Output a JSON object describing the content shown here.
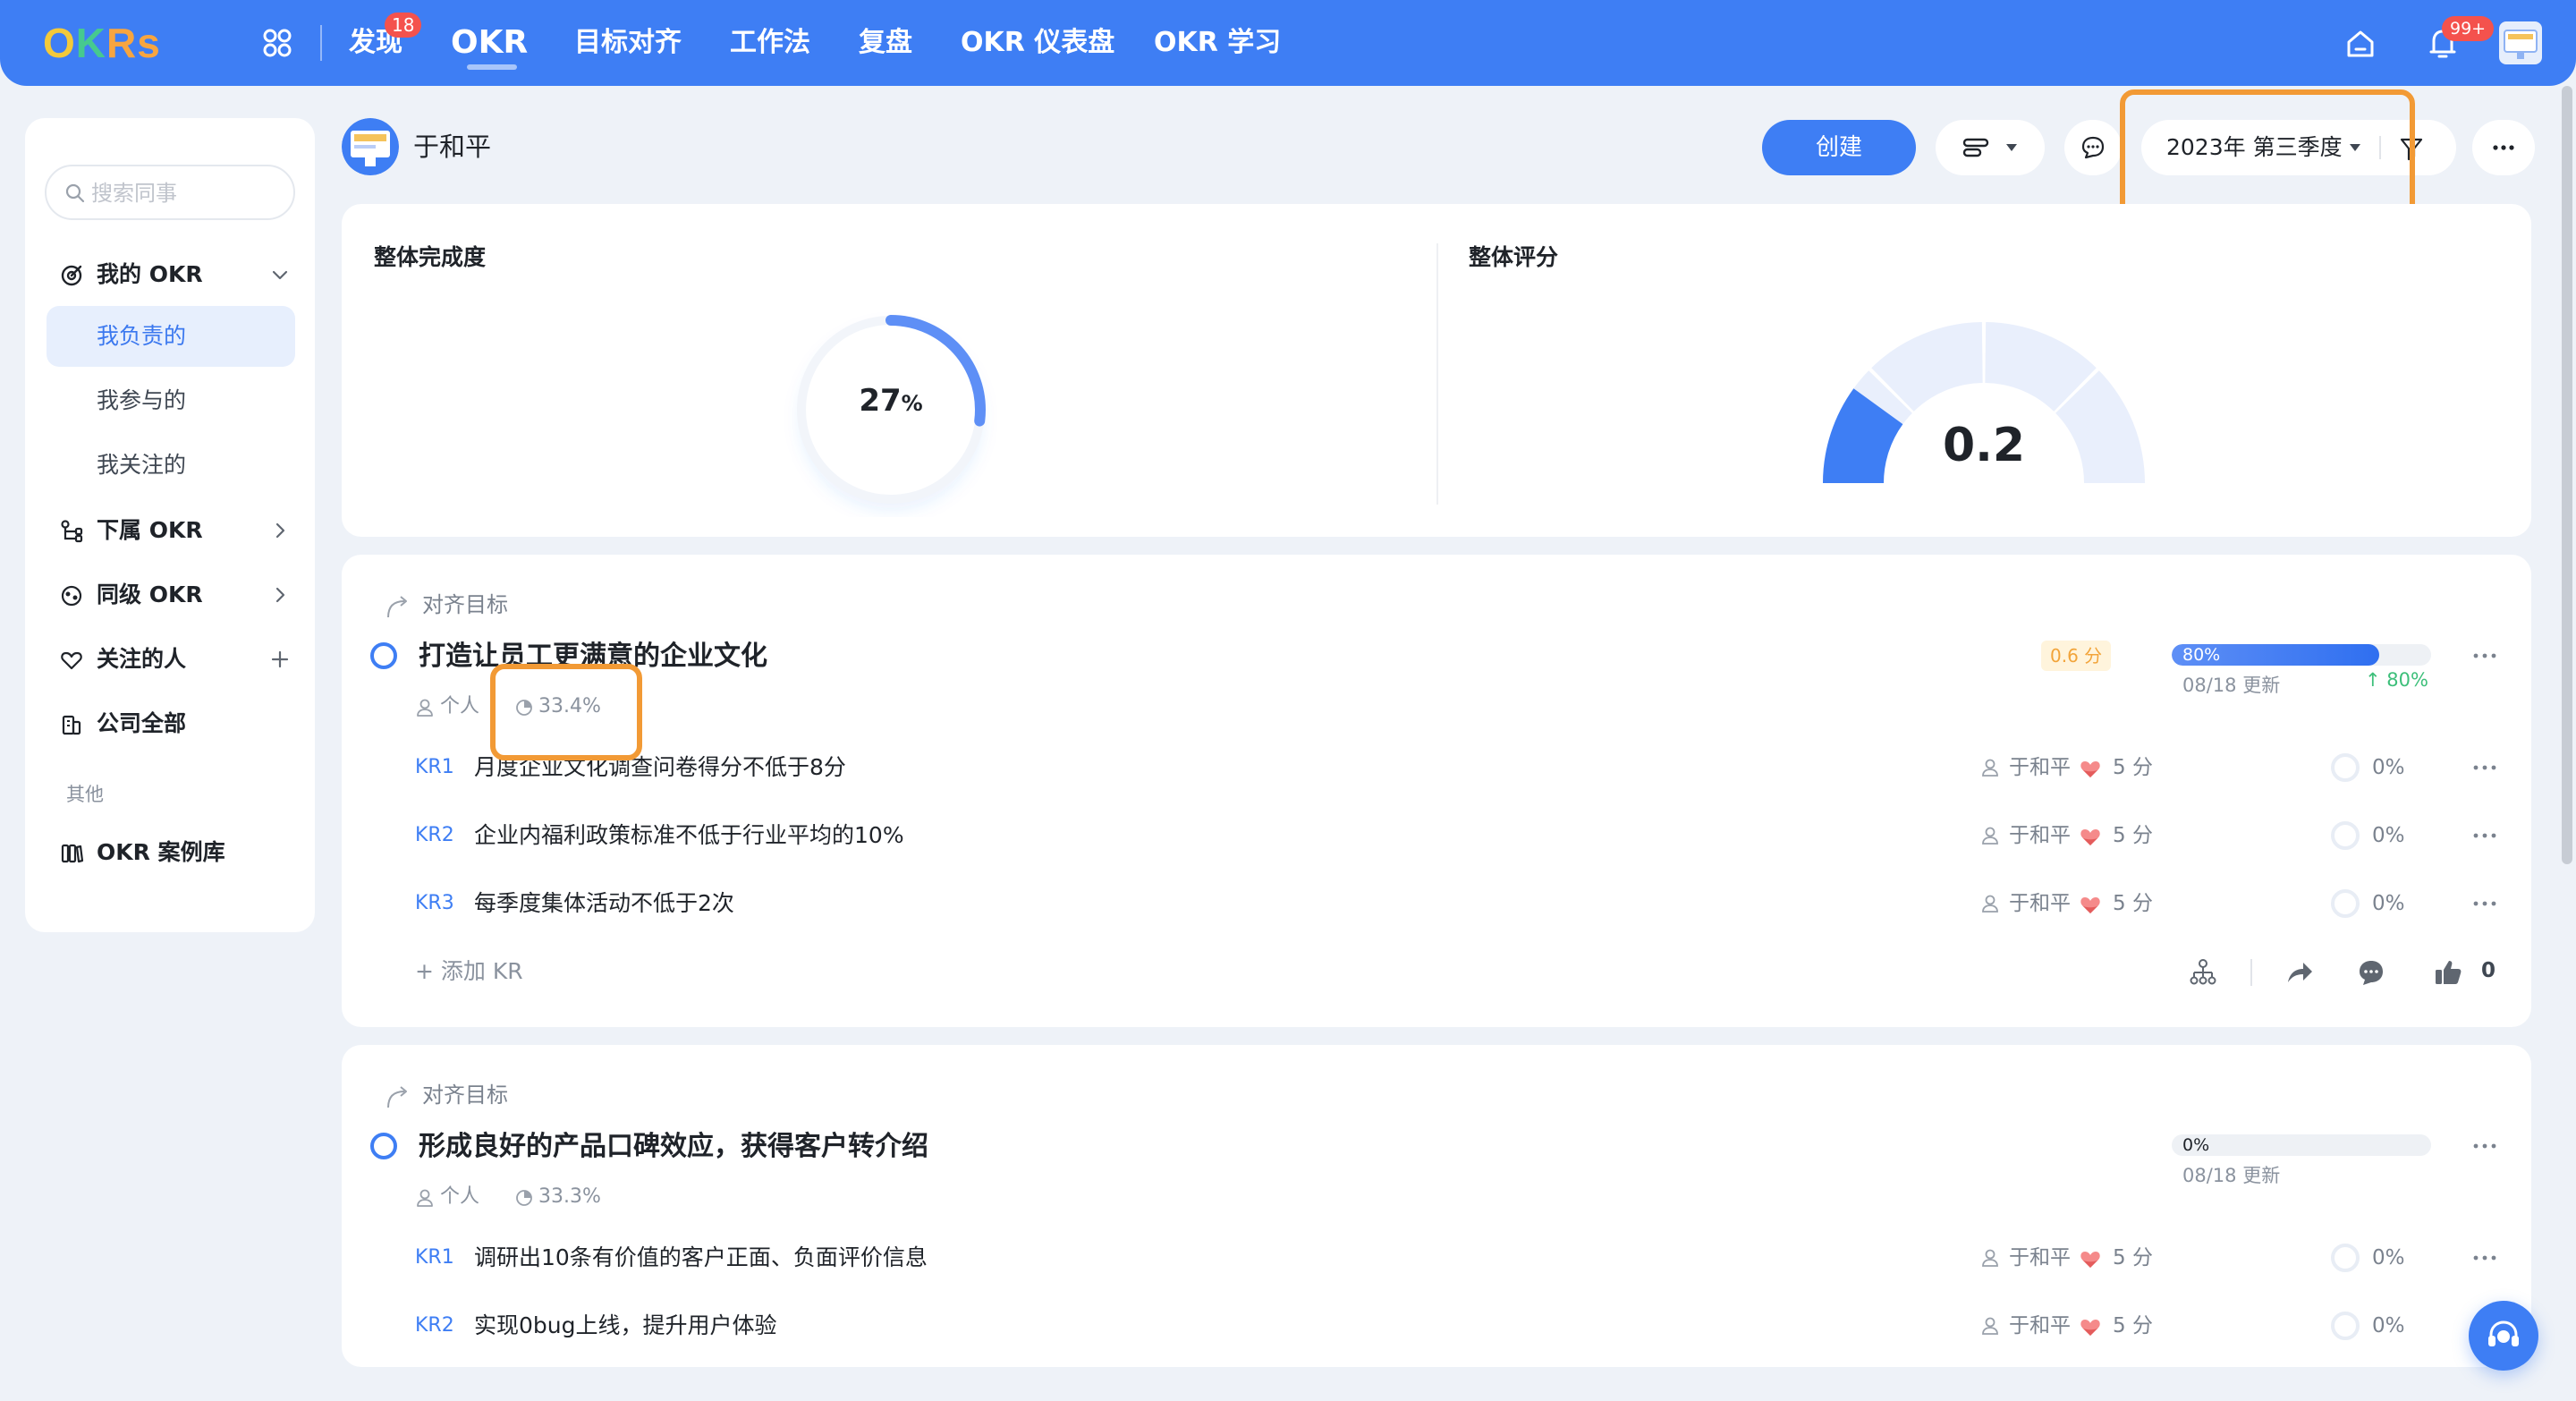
{
  "app": {
    "logo": "OKRs",
    "nav": [
      {
        "label": "发现",
        "badge": "18"
      },
      {
        "label": "OKR"
      },
      {
        "label": "目标对齐"
      },
      {
        "label": "工作法"
      },
      {
        "label": "复盘"
      },
      {
        "label": "OKR 仪表盘"
      },
      {
        "label": "OKR 学习"
      }
    ],
    "notification_badge": "99+"
  },
  "sidebar": {
    "search_placeholder": "搜索同事",
    "groups": [
      {
        "label": "我的 OKR",
        "icon": "target-icon",
        "right": "chevron-down-icon"
      },
      {
        "label": "下属 OKR",
        "icon": "org-tree-icon",
        "right": "chevron-right-icon"
      },
      {
        "label": "同级 OKR",
        "icon": "peer-icon",
        "right": "chevron-right-icon"
      },
      {
        "label": "关注的人",
        "icon": "heart-icon",
        "right": "plus-icon"
      },
      {
        "label": "公司全部",
        "icon": "building-icon"
      },
      {
        "label": "OKR 案例库",
        "icon": "library-icon"
      }
    ],
    "my_okr_items": [
      "我负责的",
      "我参与的",
      "我关注的"
    ],
    "other_label": "其他"
  },
  "header": {
    "user_name": "于和平",
    "create_label": "创建",
    "period": "2023年 第三季度"
  },
  "summary": {
    "completion_title": "整体完成度",
    "completion_value": "27",
    "completion_unit": "%",
    "completion_fraction": 0.27,
    "score_title": "整体评分",
    "score_value": "0.2",
    "score_fraction": 0.2
  },
  "objectives": [
    {
      "align_label": "对齐目标",
      "title": "打造让员工更满意的企业文化",
      "type": "个人",
      "weight": "33.4%",
      "score": "0.6 分",
      "progress": "80%",
      "progress_fraction": 0.8,
      "updated": "08/18 更新",
      "delta": "↑ 80%",
      "krs": [
        {
          "code": "KR1",
          "title": "月度企业文化调查问卷得分不低于8分",
          "owner": "于和平",
          "confidence": "5 分",
          "progress": "0%"
        },
        {
          "code": "KR2",
          "title": "企业内福利政策标准不低于行业平均的10%",
          "owner": "于和平",
          "confidence": "5 分",
          "progress": "0%"
        },
        {
          "code": "KR3",
          "title": "每季度集体活动不低于2次",
          "owner": "于和平",
          "confidence": "5 分",
          "progress": "0%"
        }
      ],
      "add_kr_label": "+ 添加 KR",
      "likes": "0"
    },
    {
      "align_label": "对齐目标",
      "title": "形成良好的产品口碑效应，获得客户转介绍",
      "type": "个人",
      "weight": "33.3%",
      "progress": "0%",
      "progress_fraction": 0,
      "updated": "08/18 更新",
      "krs": [
        {
          "code": "KR1",
          "title": "调研出10条有价值的客户正面、负面评价信息",
          "owner": "于和平",
          "confidence": "5 分",
          "progress": "0%"
        },
        {
          "code": "KR2",
          "title": "实现0bug上线，提升用户体验",
          "owner": "于和平",
          "confidence": "5 分",
          "progress": "0%"
        }
      ]
    }
  ],
  "colors": {
    "primary": "#3e7ef4",
    "highlight": "#f29a35",
    "score_tag": "#f2a43a",
    "delta_green": "#3dbf7a"
  }
}
